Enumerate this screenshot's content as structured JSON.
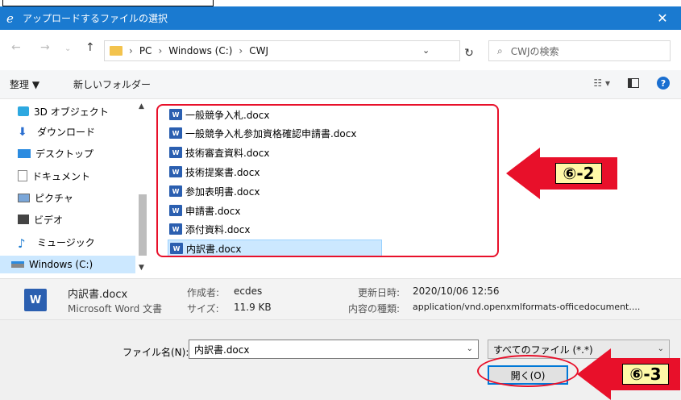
{
  "window": {
    "title": "アップロードするファイルの選択",
    "close_glyph": "✕"
  },
  "address": {
    "crumbs": [
      "PC",
      "Windows (C:)",
      "CWJ"
    ],
    "search_placeholder": "CWJの検索"
  },
  "toolbar": {
    "organize": "整理 ▼",
    "new_folder": "新しいフォルダー"
  },
  "sidebar": {
    "items": [
      {
        "label": "3D オブジェクト",
        "icon": "cube-icon",
        "color": "#2da8e0"
      },
      {
        "label": "ダウンロード",
        "icon": "download-icon",
        "color": "#2b6fd0"
      },
      {
        "label": "デスクトップ",
        "icon": "desktop-icon",
        "color": "#2b8be0"
      },
      {
        "label": "ドキュメント",
        "icon": "document-icon",
        "color": "#888888"
      },
      {
        "label": "ピクチャ",
        "icon": "picture-icon",
        "color": "#7aa6d8"
      },
      {
        "label": "ビデオ",
        "icon": "video-icon",
        "color": "#444444"
      },
      {
        "label": "ミュージック",
        "icon": "music-icon",
        "color": "#1a7ad0"
      },
      {
        "label": "Windows (C:)",
        "icon": "drive-icon",
        "color": "#666666"
      }
    ]
  },
  "files": [
    "一般競争入札.docx",
    "一般競争入札参加資格確認申請書.docx",
    "技術審査資料.docx",
    "技術提案書.docx",
    "参加表明書.docx",
    "申請書.docx",
    "添付資料.docx",
    "内訳書.docx"
  ],
  "callouts": {
    "list": "⑥-2",
    "open": "⑥-3"
  },
  "details": {
    "filename": "内訳書.docx",
    "type": "Microsoft Word 文書",
    "author_label": "作成者:",
    "author": "ecdes",
    "size_label": "サイズ:",
    "size": "11.9 KB",
    "modified_label": "更新日時:",
    "modified": "2020/10/06 12:56",
    "content_label": "内容の種類:",
    "content": "application/vnd.openxmlformats-officedocument...."
  },
  "bottom": {
    "filename_label": "ファイル名(N):",
    "filename_value": "内訳書.docx",
    "filter": "すべてのファイル (*.*)",
    "open": "開く(O)"
  },
  "colors": {
    "titlebar": "#1a7ad0",
    "accent_red": "#e8102a",
    "selection": "#cce8ff"
  }
}
